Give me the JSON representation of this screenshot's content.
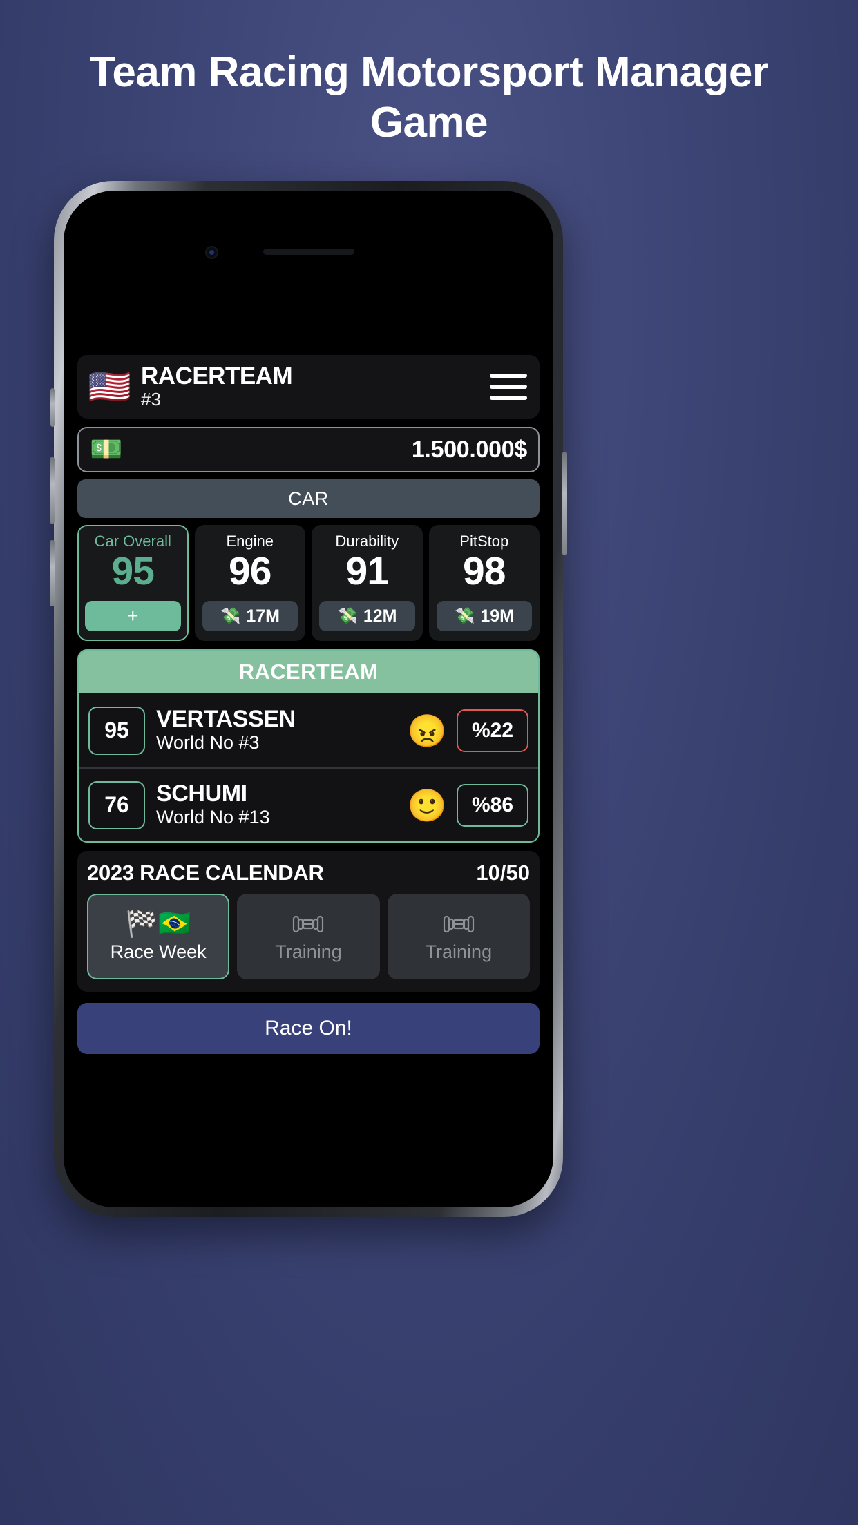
{
  "marketing": {
    "headline": "Team Racing Motorsport Manager Game"
  },
  "app": {
    "header": {
      "flag": "🇺🇸",
      "team_name": "RACERTEAM",
      "rank": "#3",
      "menu_icon": "hamburger-menu-icon"
    },
    "money": {
      "emoji": "💵",
      "value": "1.500.000$"
    },
    "section_tab": "CAR",
    "stats": [
      {
        "label": "Car Overall",
        "value": "95",
        "action": "+",
        "primary": true
      },
      {
        "label": "Engine",
        "value": "96",
        "cost": "17M",
        "emoji": "💸",
        "primary": false
      },
      {
        "label": "Durability",
        "value": "91",
        "cost": "12M",
        "emoji": "💸",
        "primary": false
      },
      {
        "label": "PitStop",
        "value": "98",
        "cost": "19M",
        "emoji": "💸",
        "primary": false
      }
    ],
    "drivers": {
      "banner": "RACERTEAM",
      "rows": [
        {
          "rating": "95",
          "name": "VERTASSEN",
          "world": "World No #3",
          "mood": "😠",
          "mood_name": "angry-face-icon",
          "percent": "%22",
          "percent_state": "bad"
        },
        {
          "rating": "76",
          "name": "SCHUMI",
          "world": "World No #13",
          "mood": "🙂",
          "mood_name": "smiling-face-icon",
          "percent": "%86",
          "percent_state": "good"
        }
      ]
    },
    "calendar": {
      "title": "2023 RACE CALENDAR",
      "count": "10/50",
      "tiles": [
        {
          "label": "Race Week",
          "icons": "🏁🇧🇷",
          "type": "race",
          "active": true
        },
        {
          "label": "Training",
          "icons": "",
          "type": "training",
          "active": false
        },
        {
          "label": "Training",
          "icons": "",
          "type": "training",
          "active": false
        }
      ]
    },
    "race_on_label": "Race On!"
  }
}
